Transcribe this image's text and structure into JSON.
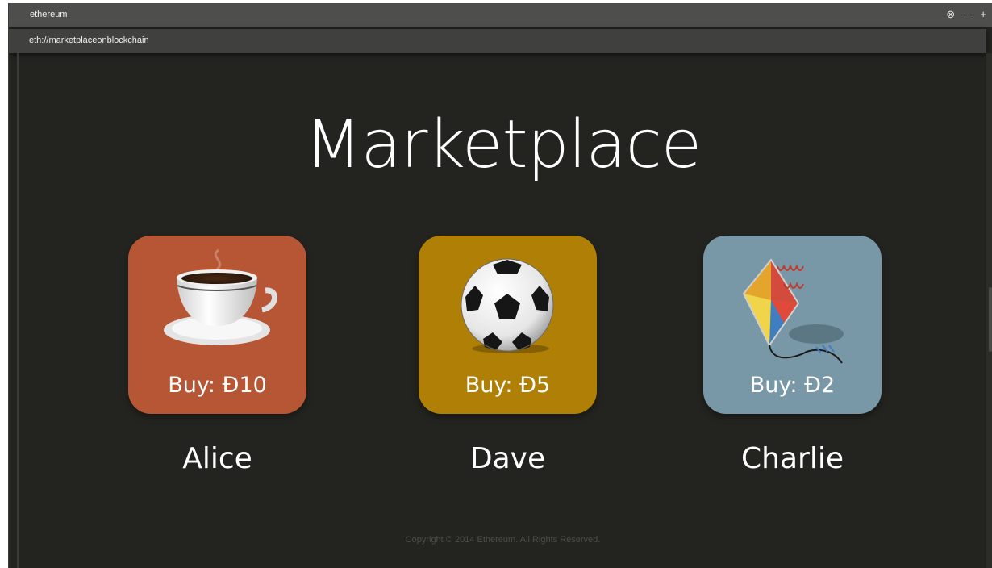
{
  "window": {
    "title": "ethereum",
    "controls": {
      "close": "⊗",
      "minimize": "–",
      "maximize": "+"
    }
  },
  "address_bar": {
    "url": "eth://marketplaceonblockchain"
  },
  "page": {
    "heading": "Marketplace",
    "items": [
      {
        "seller": "Alice",
        "buy_label": "Buy: Đ10",
        "icon": "coffee-cup-icon",
        "color": "#b65635"
      },
      {
        "seller": "Dave",
        "buy_label": "Buy: Đ5",
        "icon": "soccer-ball-icon",
        "color": "#b07f06"
      },
      {
        "seller": "Charlie",
        "buy_label": "Buy: Đ2",
        "icon": "kite-icon",
        "color": "#7897a7"
      }
    ],
    "footer": "Copyright © 2014 Ethereum. All Rights Reserved."
  }
}
